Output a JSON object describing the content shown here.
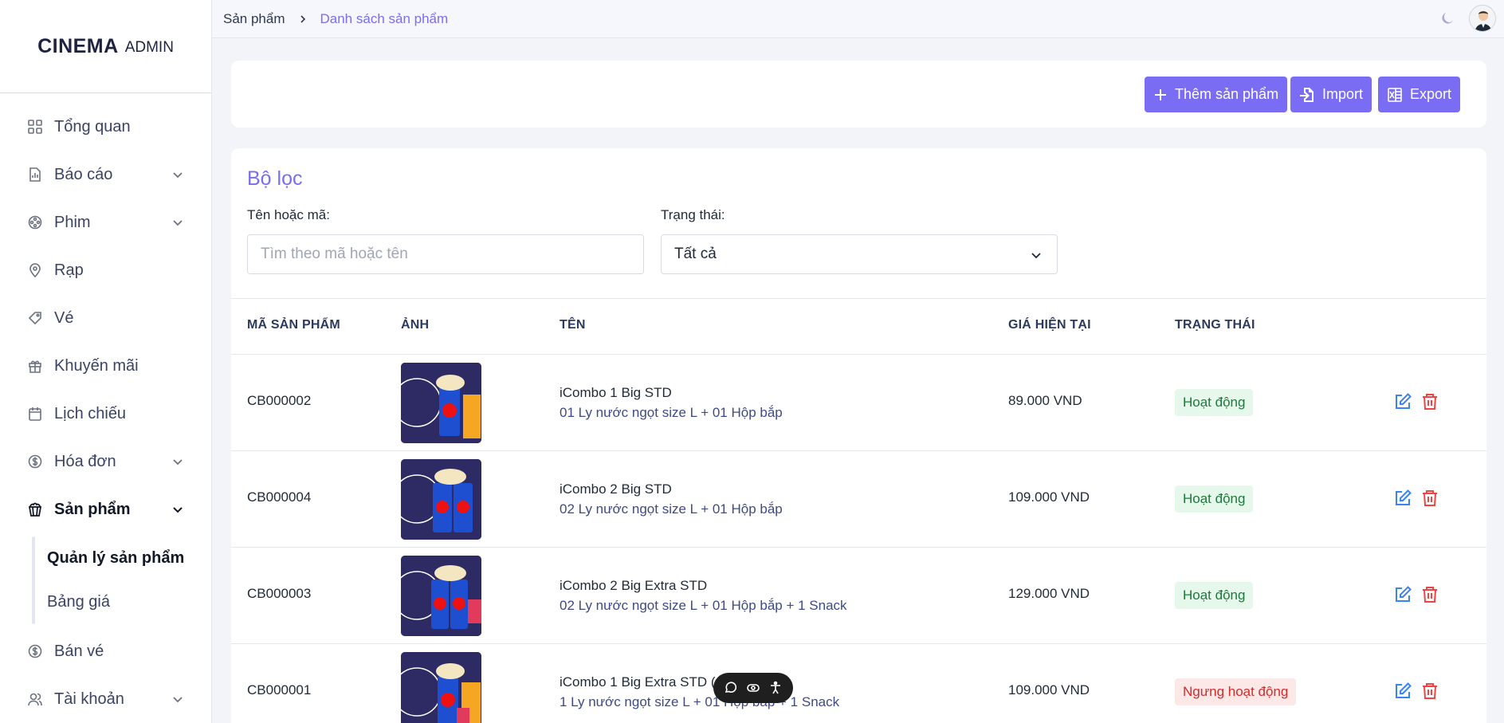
{
  "app": {
    "brand": "CINEMA",
    "brand_sub": "ADMIN"
  },
  "sidebar": {
    "items": [
      {
        "label": "Tổng quan",
        "icon": "grid-icon",
        "has_children": false
      },
      {
        "label": "Báo cáo",
        "icon": "report-icon",
        "has_children": true
      },
      {
        "label": "Phim",
        "icon": "film-reel-icon",
        "has_children": true
      },
      {
        "label": "Rạp",
        "icon": "location-pin-icon",
        "has_children": false
      },
      {
        "label": "Vé",
        "icon": "ticket-icon",
        "has_children": false
      },
      {
        "label": "Khuyến mãi",
        "icon": "gift-icon",
        "has_children": false
      },
      {
        "label": "Lịch chiếu",
        "icon": "calendar-icon",
        "has_children": false
      },
      {
        "label": "Hóa đơn",
        "icon": "dollar-circle-icon",
        "has_children": true
      },
      {
        "label": "Sản phẩm",
        "icon": "popcorn-icon",
        "has_children": true,
        "active": true
      }
    ],
    "sub_items": [
      {
        "label": "Quản lý sản phẩm",
        "active": true
      },
      {
        "label": "Bảng giá",
        "active": false
      }
    ],
    "items_after": [
      {
        "label": "Bán vé",
        "icon": "dollar-circle-icon",
        "has_children": false
      },
      {
        "label": "Tài khoản",
        "icon": "users-icon",
        "has_children": true
      }
    ]
  },
  "breadcrumb": {
    "parent": "Sản phẩm",
    "current": "Danh sách sản phẩm"
  },
  "toolbar": {
    "add_label": "Thêm sản phẩm",
    "import_label": "Import",
    "export_label": "Export"
  },
  "filter": {
    "title": "Bộ lọc",
    "search_label": "Tên hoặc mã:",
    "search_placeholder": "Tìm theo mã hoặc tên",
    "search_value": "",
    "status_label": "Trạng thái:",
    "status_value": "Tất cả"
  },
  "table": {
    "columns": [
      "MÃ SẢN PHẨM",
      "ẢNH",
      "TÊN",
      "GIÁ HIỆN TẠI",
      "TRẠNG THÁI"
    ],
    "rows": [
      {
        "code": "CB000002",
        "name": "iCombo 1 Big STD",
        "desc": "01 Ly nước ngọt size L + 01 Hộp bắp",
        "price": "89.000 VND",
        "status": "Hoạt động",
        "active": true
      },
      {
        "code": "CB000004",
        "name": "iCombo 2 Big STD",
        "desc": "02 Ly nước ngọt size L + 01 Hộp bắp",
        "price": "109.000 VND",
        "status": "Hoạt động",
        "active": true
      },
      {
        "code": "CB000003",
        "name": "iCombo 2 Big Extra STD",
        "desc": "02 Ly nước ngọt size L + 01 Hộp bắp + 1 Snack",
        "price": "129.000 VND",
        "status": "Hoạt động",
        "active": true
      },
      {
        "code": "CB000001",
        "name": "iCombo 1 Big Extra STD (",
        "desc": "1 Ly nước ngọt size L + 01 Hộp bắp + 1 Snack",
        "price": "109.000 VND",
        "status": "Ngưng hoạt động",
        "active": false
      }
    ]
  },
  "colors": {
    "accent": "#7b6cf4",
    "active_badge_bg": "#e6f7ec",
    "active_badge_text": "#1c7a3a",
    "inactive_badge_bg": "#fde8e8",
    "inactive_badge_text": "#d12c2c",
    "edit_icon": "#3b82f6",
    "delete_icon": "#ef4444"
  }
}
